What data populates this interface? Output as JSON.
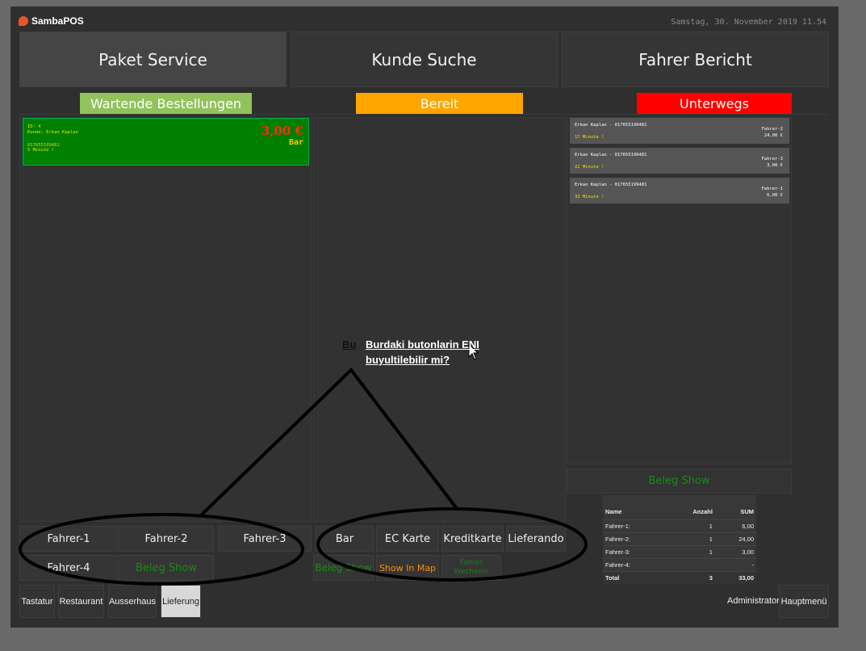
{
  "app": {
    "logo_text": "SambaPOS",
    "datetime": "Samstag, 30. November 2019 11.54"
  },
  "top_buttons": [
    "Paket Service",
    "Kunde Suche",
    "Fahrer Bericht"
  ],
  "columns": {
    "waiting": {
      "label": "Wartende Bestellungen",
      "color": "#92c25b"
    },
    "ready": {
      "label": "Bereit",
      "color": "#ffa500"
    },
    "en_route": {
      "label": "Unterwegs",
      "color": "#ff0000"
    }
  },
  "waiting_order": {
    "id_line": "ID: 4",
    "customer_line": "Kunde: Erkan Kaplan",
    "phone": "017655199481",
    "time": "5 Minute !",
    "price": "3,00 €",
    "payment": "Bar"
  },
  "en_route_orders": [
    {
      "name": "Erkan Kaplan - 017655199481",
      "time": "17 Minute !",
      "driver": "Fahrer-2",
      "amount": "24,00 €"
    },
    {
      "name": "Erkan Kaplan - 017655199481",
      "time": "22 Minute !",
      "driver": "Fahrer-3",
      "amount": "3,00 €"
    },
    {
      "name": "Erkan Kaplan - 017655199481",
      "time": "33 Minute !",
      "driver": "Fahrer-1",
      "amount": "6,00 €"
    }
  ],
  "driver_buttons": [
    "Fahrer-1",
    "Fahrer-2",
    "Fahrer-3",
    "Fahrer-4"
  ],
  "beleg_show": "Beleg Show",
  "payment_buttons": [
    "Bar",
    "EC Karte",
    "Kreditkarte",
    "Lieferando"
  ],
  "show_in_map": "Show In Map",
  "fahrer_wechseln": "Fahrer Wechseln",
  "summary": {
    "headers": [
      "Name",
      "Anzahl",
      "SUM"
    ],
    "rows": [
      [
        "Fahrer-1:",
        "1",
        "6,00"
      ],
      [
        "Fahrer-2:",
        "1",
        "24,00"
      ],
      [
        "Fahrer-3:",
        "1",
        "3,00"
      ],
      [
        "Fahrer-4:",
        "",
        "-"
      ]
    ],
    "total": [
      "Total",
      "3",
      "33,00"
    ]
  },
  "bottom_tabs": [
    "Tastatur",
    "Restaurant",
    "Ausserhaus",
    "Lieferung"
  ],
  "user": "Administrator",
  "main_menu": "Hauptmenü",
  "annotation": {
    "prefix": "Bu",
    "text_line1": "Burdaki butonlarin ENI",
    "text_line2": "buyultilebilir mi?"
  }
}
